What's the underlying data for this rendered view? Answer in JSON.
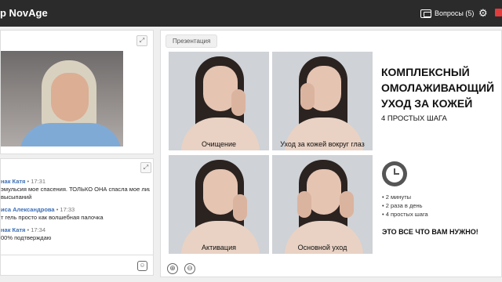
{
  "header": {
    "app_title": "p NovAge",
    "questions_label": "Вопросы (5)",
    "icons": [
      "questions-icon",
      "gear-icon",
      "camera-icon"
    ]
  },
  "video": {
    "expand_icon": "expand-icon"
  },
  "chat": {
    "messages": [
      {
        "author": "нак Катя",
        "sep": " • ",
        "time": "17:31",
        "lines": [
          "эмульсия мое спасения. ТОЛЬКО ОНА спасла мое лицо",
          "высыпаний"
        ]
      },
      {
        "author": "иса Александрова",
        "sep": " • ",
        "time": "17:33",
        "lines": [
          "т гель просто как волшебная палочка"
        ]
      },
      {
        "author": "нак Катя",
        "sep": " • ",
        "time": "17:34",
        "lines": [
          "00% подтверждаю"
        ]
      }
    ],
    "emoji_icon": "emoji-icon"
  },
  "presentation": {
    "tab_label": "Презентация",
    "slide": {
      "title_lines": [
        "КОМПЛЕКСНЫЙ",
        "ОМОЛАЖИВАЮЩИЙ",
        "УХОД ЗА КОЖЕЙ"
      ],
      "subtitle": "4 ПРОСТЫХ ШАГА",
      "captions": [
        "Очищение",
        "Уход за кожей вокруг глаз",
        "Активация",
        "Основной уход"
      ],
      "bullets": [
        "• 2 минуты",
        "• 2 раза в день",
        "• 4 простых шага"
      ],
      "cta": "ЭТО ВСЕ ЧТО ВАМ НУЖНО!"
    },
    "zoom_in": "⊕",
    "zoom_out": "⊖"
  }
}
